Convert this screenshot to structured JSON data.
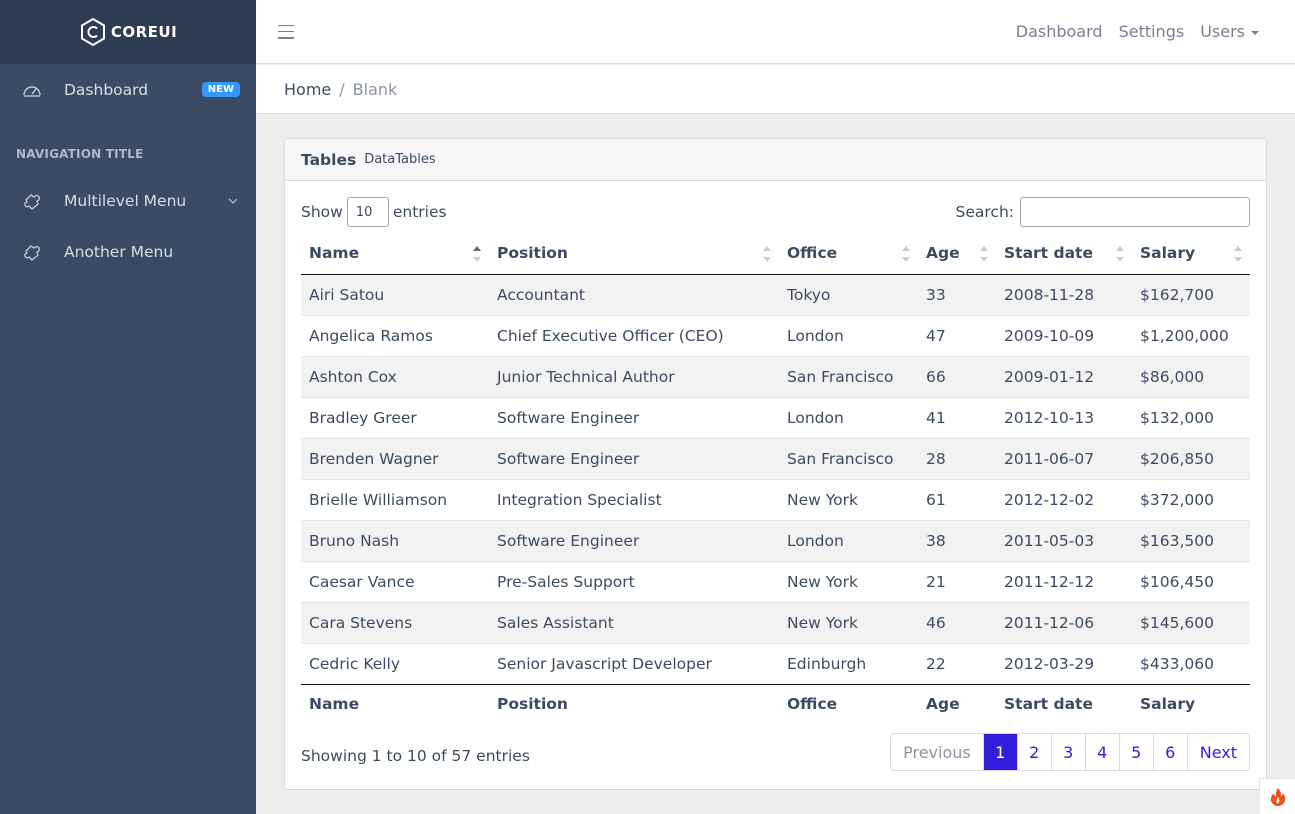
{
  "brand": {
    "text": "COREUI"
  },
  "sidebar": {
    "items": [
      {
        "label": "Dashboard",
        "icon": "speedometer-icon",
        "badge": "NEW"
      },
      {
        "label": "Multilevel Menu",
        "icon": "puzzle-icon"
      },
      {
        "label": "Another Menu",
        "icon": "puzzle-icon"
      }
    ],
    "nav_title": "NAVIGATION TITLE"
  },
  "header": {
    "links": [
      "Dashboard",
      "Settings",
      "Users"
    ]
  },
  "breadcrumb": {
    "home": "Home",
    "separator": "/",
    "active": "Blank"
  },
  "card": {
    "title": "Tables",
    "subtitle": "DataTables"
  },
  "controls": {
    "show_label": "Show",
    "entries_value": "10",
    "entries_label": "entries",
    "search_label": "Search:",
    "search_value": ""
  },
  "table": {
    "columns": [
      "Name",
      "Position",
      "Office",
      "Age",
      "Start date",
      "Salary"
    ],
    "rows": [
      [
        "Airi Satou",
        "Accountant",
        "Tokyo",
        "33",
        "2008-11-28",
        "$162,700"
      ],
      [
        "Angelica Ramos",
        "Chief Executive Officer (CEO)",
        "London",
        "47",
        "2009-10-09",
        "$1,200,000"
      ],
      [
        "Ashton Cox",
        "Junior Technical Author",
        "San Francisco",
        "66",
        "2009-01-12",
        "$86,000"
      ],
      [
        "Bradley Greer",
        "Software Engineer",
        "London",
        "41",
        "2012-10-13",
        "$132,000"
      ],
      [
        "Brenden Wagner",
        "Software Engineer",
        "San Francisco",
        "28",
        "2011-06-07",
        "$206,850"
      ],
      [
        "Brielle Williamson",
        "Integration Specialist",
        "New York",
        "61",
        "2012-12-02",
        "$372,000"
      ],
      [
        "Bruno Nash",
        "Software Engineer",
        "London",
        "38",
        "2011-05-03",
        "$163,500"
      ],
      [
        "Caesar Vance",
        "Pre-Sales Support",
        "New York",
        "21",
        "2011-12-12",
        "$106,450"
      ],
      [
        "Cara Stevens",
        "Sales Assistant",
        "New York",
        "46",
        "2011-12-06",
        "$145,600"
      ],
      [
        "Cedric Kelly",
        "Senior Javascript Developer",
        "Edinburgh",
        "22",
        "2012-03-29",
        "$433,060"
      ]
    ]
  },
  "info": "Showing 1 to 10 of 57 entries",
  "pagination": {
    "previous": "Previous",
    "pages": [
      "1",
      "2",
      "3",
      "4",
      "5",
      "6"
    ],
    "active": "1",
    "next": "Next"
  },
  "colors": {
    "sidebar_bg": "#3c4b64",
    "brand_bg": "#303c54",
    "primary": "#321fdb",
    "badge": "#3399ff"
  }
}
